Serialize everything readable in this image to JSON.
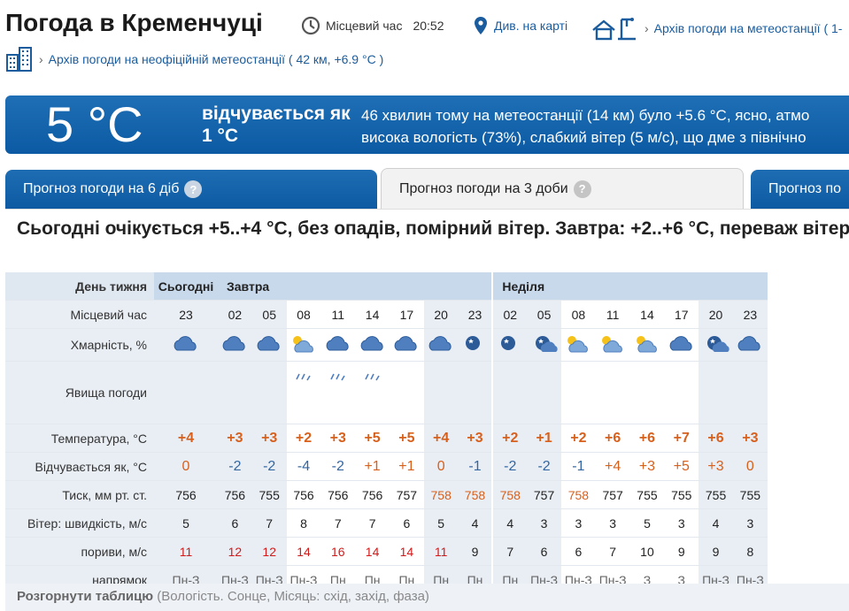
{
  "header": {
    "title": "Погода в Кременчуці",
    "local_time_label": "Місцевий час",
    "local_time": "20:52",
    "map_link": "Див. на карті",
    "archive_link": "Архів погоди на метеостанції  ( 1-",
    "archive_unofficial": "Архів погоди на неофіційній метеостанції  ( 42 км, +6.9 °C )"
  },
  "now": {
    "temp": "5 °C",
    "feels_like": "відчувається як 1 °C",
    "description_line1": "46 хвилин тому на метеостанції (14 км) було +5.6 °C, ясно, атмо",
    "description_line2": "висока вологість (73%), слабкий вітер (5 м/с), що дме з північно"
  },
  "tabs": [
    {
      "label": "Прогноз погоди на 6 діб",
      "help": "?"
    },
    {
      "label": "Прогноз погоди на 3 доби",
      "help": "?"
    },
    {
      "label": "Прогноз по"
    }
  ],
  "summary": "Сьогодні очікується +5..+4 °C, без опадів, помірний вітер. Завтра: +2..+6 °C, переваж вітер.",
  "table": {
    "labels": {
      "day": "День тижня",
      "time": "Місцевий час",
      "cloud": "Хмарність, %",
      "phenom": "Явища погоди",
      "temp": "Температура, °C",
      "feels": "Відчувається як, °C",
      "pressure": "Тиск, мм рт. ст.",
      "wind": "Вітер: швидкість, м/с",
      "gusts": "пориви, м/с",
      "direction": "напрямок"
    },
    "days": [
      "Сьогодні",
      "Завтра",
      "Неділя"
    ],
    "times": [
      "23",
      "02",
      "05",
      "08",
      "11",
      "14",
      "17",
      "20",
      "23",
      "02",
      "05",
      "08",
      "11",
      "14",
      "17",
      "20",
      "23"
    ],
    "temps": [
      "+4",
      "+3",
      "+3",
      "+2",
      "+3",
      "+5",
      "+5",
      "+4",
      "+3",
      "+2",
      "+1",
      "+2",
      "+6",
      "+6",
      "+7",
      "+6",
      "+3"
    ],
    "feels": [
      "0",
      "-2",
      "-2",
      "-4",
      "-2",
      "+1",
      "+1",
      "0",
      "-1",
      "-2",
      "-2",
      "-1",
      "+4",
      "+3",
      "+5",
      "+3",
      "0"
    ],
    "pressure": [
      "756",
      "756",
      "755",
      "756",
      "756",
      "756",
      "757",
      "758",
      "758",
      "758",
      "757",
      "758",
      "757",
      "755",
      "755",
      "755",
      "755"
    ],
    "wind": [
      "5",
      "6",
      "7",
      "8",
      "7",
      "7",
      "6",
      "5",
      "4",
      "4",
      "3",
      "3",
      "3",
      "5",
      "3",
      "4",
      "3"
    ],
    "gusts": [
      "11",
      "12",
      "12",
      "14",
      "16",
      "14",
      "14",
      "11",
      "9",
      "7",
      "6",
      "6",
      "7",
      "10",
      "9",
      "9",
      "8"
    ],
    "direction": [
      "Пн-З",
      "Пн-З",
      "Пн-З",
      "Пн-З",
      "Пн",
      "Пн",
      "Пн",
      "Пн",
      "Пн",
      "Пн",
      "Пн-З",
      "Пн-З",
      "Пн-З",
      "З",
      "З",
      "Пн-З",
      "Пн-З"
    ]
  },
  "expand": {
    "label": "Розгорнути таблицю",
    "detail": "(Вологість. Сонце, Місяць: схід, захід, фаза)"
  },
  "colors": {
    "accent": "#1a5c9e",
    "warm": "#d7601d",
    "cold": "#3466a0",
    "gust": "#d21a1a"
  }
}
